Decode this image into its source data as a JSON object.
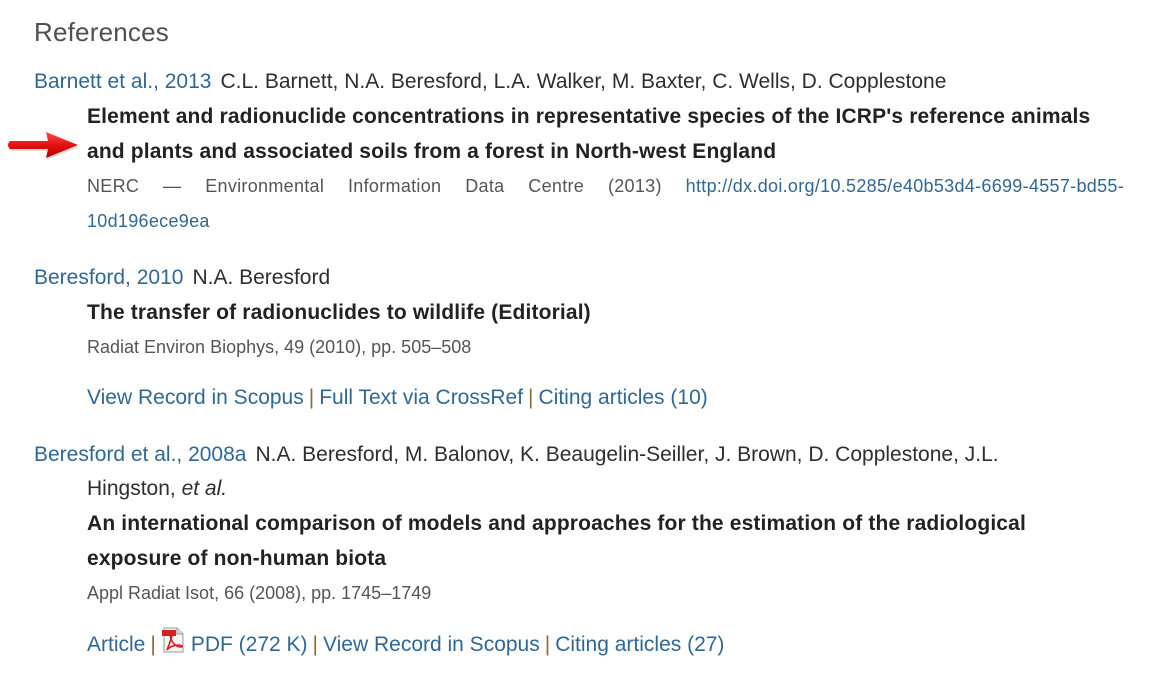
{
  "heading": "References",
  "references": [
    {
      "cite": "Barnett et al., 2013",
      "authors": "C.L. Barnett, N.A. Beresford, L.A. Walker, M. Baxter, C. Wells, D. Copplestone",
      "title": "Element and radionuclide concentrations in representative species of the ICRP's reference animals and plants and associated soils from a forest in North-west England",
      "source": "NERC — Environmental Information Data Centre (2013)",
      "doi": "http://dx.doi.org/10.5285/e40b53d4-6699-4557-bd55-10d196ece9ea",
      "highlighted": true
    },
    {
      "cite": "Beresford, 2010",
      "authors": "N.A. Beresford",
      "title": "The transfer of radionuclides to wildlife (Editorial)",
      "source": "Radiat Environ Biophys, 49 (2010), pp. 505–508",
      "links": [
        "View Record in Scopus",
        "Full Text via CrossRef",
        "Citing articles (10)"
      ]
    },
    {
      "cite": "Beresford et al., 2008a",
      "authors": "N.A. Beresford, M. Balonov, K. Beaugelin-Seiller, J. Brown, D. Copplestone, J.L.",
      "authors_cont": "Hingston,",
      "authors_etal": "et al.",
      "title": "An international comparison of models and approaches for the estimation of the radiological exposure of non-human biota",
      "source": "Appl Radiat Isot, 66 (2008), pp. 1745–1749",
      "links": [
        "Article",
        "PDF (272 K)",
        "View Record in Scopus",
        "Citing articles (27)"
      ]
    }
  ],
  "separator": "|",
  "icons": {
    "arrow": "red-arrow-pointer",
    "pdf": "pdf-file-icon"
  },
  "colors": {
    "link": "#2f6795",
    "arrow": "#e01010",
    "pdf": "#d42020"
  }
}
